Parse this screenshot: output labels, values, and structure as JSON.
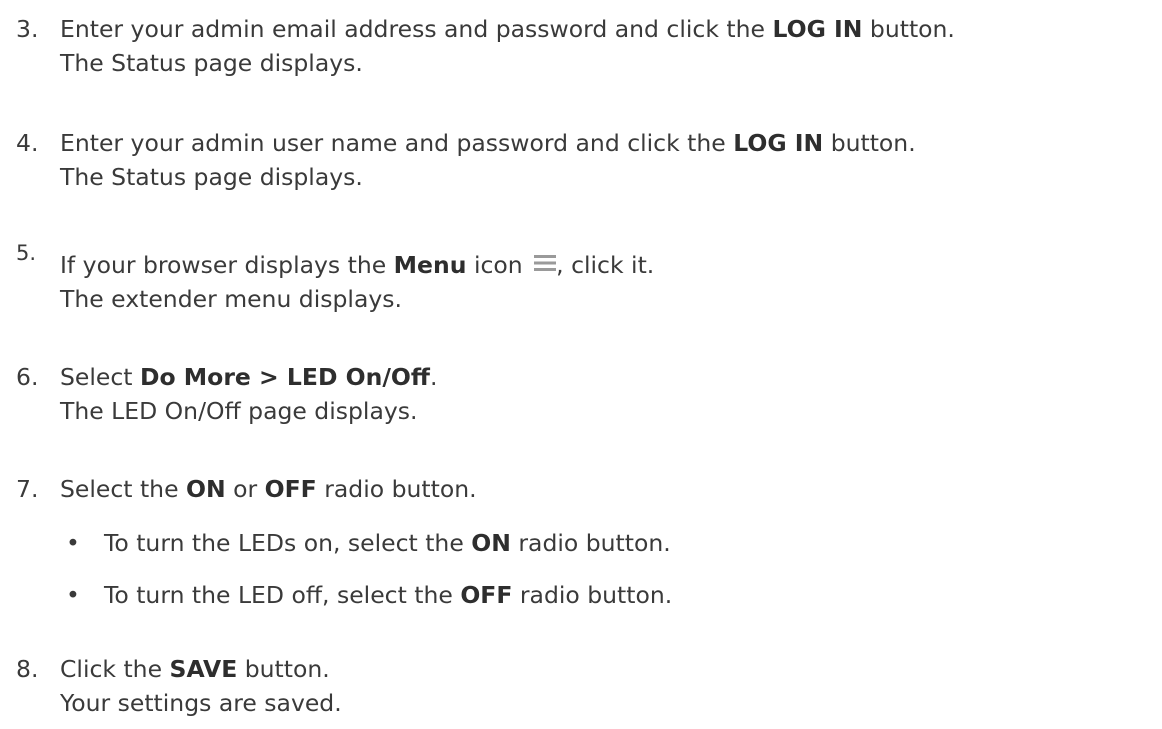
{
  "steps": [
    {
      "number": "3.",
      "line1": [
        "Enter your admin email address and password and click the ",
        "LOG IN",
        " button."
      ],
      "line2": "The Status page displays."
    },
    {
      "number": "4.",
      "line1": [
        "Enter your admin user name and password and click the ",
        "LOG IN",
        " button."
      ],
      "line2": "The Status page displays."
    },
    {
      "number": "5.",
      "line1": [
        "If your browser displays the ",
        "Menu",
        " icon ",
        ", click it."
      ],
      "line2": "The extender menu displays.",
      "icon": "menu-icon"
    },
    {
      "number": "6.",
      "line1": [
        "Select ",
        "Do More > LED On/Off",
        "."
      ],
      "line2": "The LED On/Off page displays."
    },
    {
      "number": "7.",
      "line1": [
        "Select the ",
        "ON",
        " or ",
        "OFF",
        " radio button."
      ],
      "bullets": [
        [
          "To turn the LEDs on, select the ",
          "ON",
          " radio button."
        ],
        [
          "To turn the LED off, select the ",
          "OFF",
          " radio button."
        ]
      ]
    },
    {
      "number": "8.",
      "line1": [
        "Click the ",
        "SAVE",
        " button."
      ],
      "line2": "Your settings are saved."
    }
  ],
  "bullet_char": "•",
  "colors": {
    "text": "#3a3a3a",
    "icon": "#9a9a9a"
  }
}
